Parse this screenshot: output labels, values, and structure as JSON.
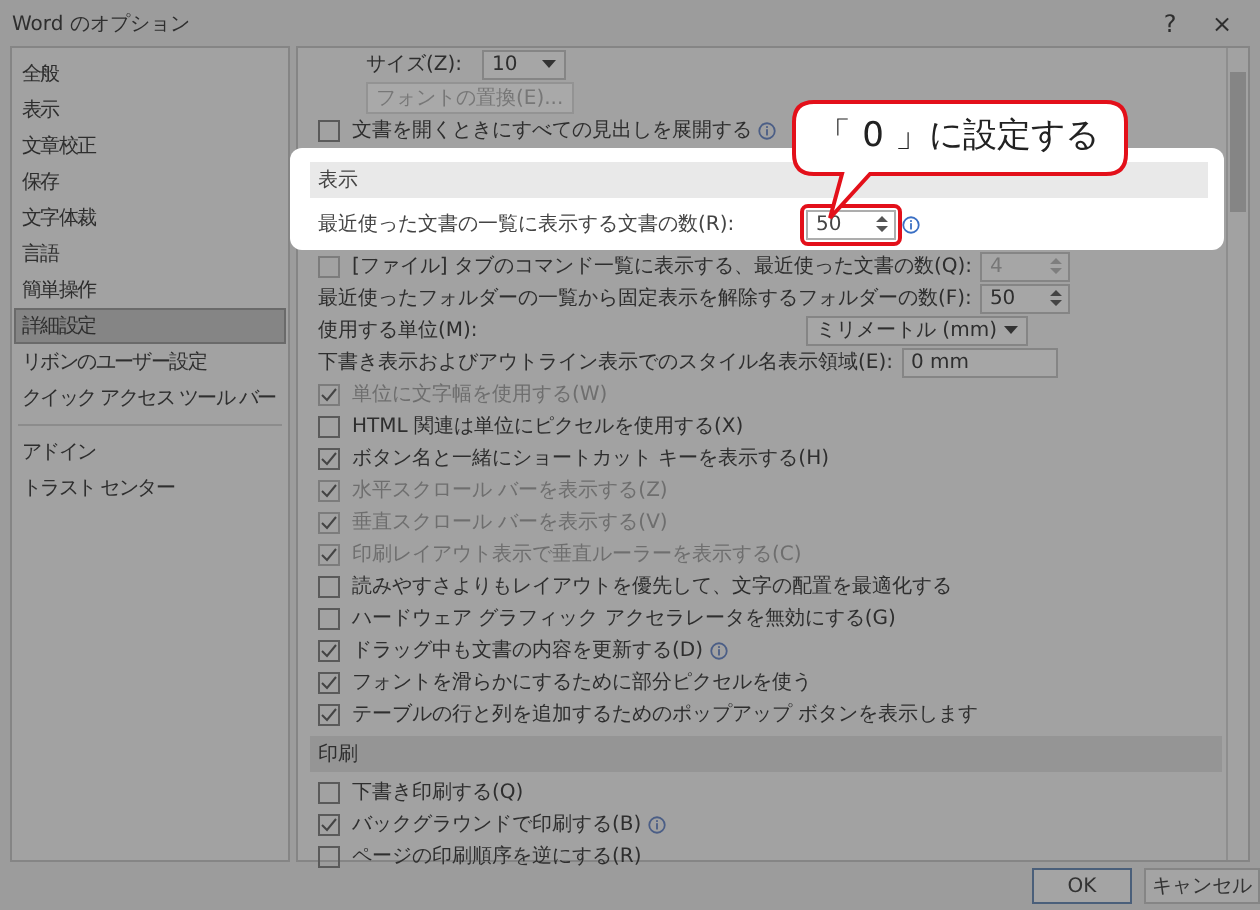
{
  "window": {
    "title": "Word のオプション",
    "help": "?",
    "close": "×"
  },
  "sidebar": {
    "groups": [
      [
        {
          "label": "全般",
          "selected": false
        },
        {
          "label": "表示",
          "selected": false
        },
        {
          "label": "文章校正",
          "selected": false
        },
        {
          "label": "保存",
          "selected": false
        },
        {
          "label": "文字体裁",
          "selected": false
        },
        {
          "label": "言語",
          "selected": false
        },
        {
          "label": "簡単操作",
          "selected": false
        },
        {
          "label": "詳細設定",
          "selected": true
        },
        {
          "label": "リボンのユーザー設定",
          "selected": false
        },
        {
          "label": "クイック アクセス ツール バー",
          "selected": false
        }
      ],
      [
        {
          "label": "アドイン",
          "selected": false
        },
        {
          "label": "トラスト センター",
          "selected": false
        }
      ]
    ]
  },
  "rows": [
    {
      "kind": "dropdown",
      "label": "サイズ(Z):",
      "value": "10",
      "indent": true
    },
    {
      "kind": "button",
      "label": "フォントの置換(E)...",
      "disabled": true
    },
    {
      "kind": "checkbox",
      "label": "文書を開くときにすべての見出しを展開する",
      "checked": false,
      "disabled": false,
      "info": true
    },
    {
      "kind": "highlight",
      "rows": [
        {
          "kind": "section",
          "label": "表示"
        },
        {
          "kind": "spin",
          "label": "最近使った文書の一覧に表示する文書の数(R):",
          "value": "50",
          "disabled": false,
          "circled": true,
          "info": true
        }
      ]
    },
    {
      "kind": "checkspin",
      "label": "[ファイル] タブのコマンド一覧に表示する、最近使った文書の数(Q):",
      "value": "4",
      "checked": false,
      "disabled": true
    },
    {
      "kind": "spin",
      "label": "最近使ったフォルダーの一覧から固定表示を解除するフォルダーの数(F):",
      "value": "50",
      "disabled": false,
      "circled": false,
      "info": false
    },
    {
      "kind": "dropdown",
      "label": "使用する単位(M):",
      "value": "ミリメートル (mm)",
      "indent": false
    },
    {
      "kind": "text",
      "label": "下書き表示およびアウトライン表示でのスタイル名表示領域(E):",
      "value": "0 mm"
    },
    {
      "kind": "checkbox",
      "label": "単位に文字幅を使用する(W)",
      "checked": true,
      "disabled": true,
      "info": false
    },
    {
      "kind": "checkbox",
      "label": "HTML 関連は単位にピクセルを使用する(X)",
      "checked": false,
      "disabled": false,
      "info": false
    },
    {
      "kind": "checkbox",
      "label": "ボタン名と一緒にショートカット キーを表示する(H)",
      "checked": true,
      "disabled": false,
      "info": false
    },
    {
      "kind": "checkbox",
      "label": "水平スクロール バーを表示する(Z)",
      "checked": true,
      "disabled": true,
      "info": false
    },
    {
      "kind": "checkbox",
      "label": "垂直スクロール バーを表示する(V)",
      "checked": true,
      "disabled": true,
      "info": false
    },
    {
      "kind": "checkbox",
      "label": "印刷レイアウト表示で垂直ルーラーを表示する(C)",
      "checked": true,
      "disabled": true,
      "info": false
    },
    {
      "kind": "checkbox",
      "label": "読みやすさよりもレイアウトを優先して、文字の配置を最適化する",
      "checked": false,
      "disabled": false,
      "info": false
    },
    {
      "kind": "checkbox",
      "label": "ハードウェア グラフィック アクセラレータを無効にする(G)",
      "checked": false,
      "disabled": false,
      "info": false
    },
    {
      "kind": "checkbox",
      "label": "ドラッグ中も文書の内容を更新する(D)",
      "checked": true,
      "disabled": false,
      "info": true
    },
    {
      "kind": "checkbox",
      "label": "フォントを滑らかにするために部分ピクセルを使う",
      "checked": true,
      "disabled": false,
      "info": false
    },
    {
      "kind": "checkbox",
      "label": "テーブルの行と列を追加するためのポップアップ ボタンを表示します",
      "checked": true,
      "disabled": false,
      "info": false
    },
    {
      "kind": "section",
      "label": "印刷"
    },
    {
      "kind": "checkbox",
      "label": "下書き印刷する(Q)",
      "checked": false,
      "disabled": false,
      "info": false
    },
    {
      "kind": "checkbox",
      "label": "バックグラウンドで印刷する(B)",
      "checked": true,
      "disabled": false,
      "info": true
    },
    {
      "kind": "checkbox",
      "label": "ページの印刷順序を逆にする(R)",
      "checked": false,
      "disabled": false,
      "info": false
    }
  ],
  "callout": {
    "text": "「 0 」に設定する"
  },
  "buttons": [
    {
      "label": "OK",
      "default": true
    },
    {
      "label": "キャンセル",
      "default": false
    }
  ]
}
